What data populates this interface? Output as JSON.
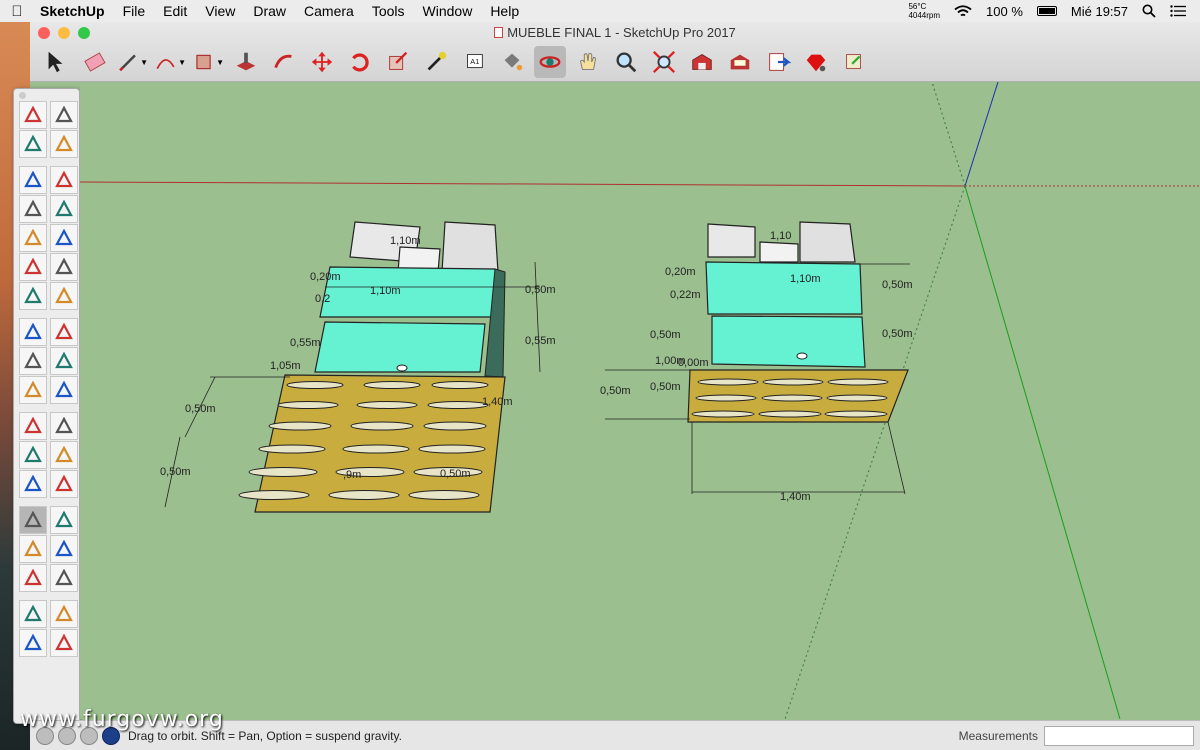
{
  "menubar": {
    "apple_icon": "apple-icon",
    "items": [
      "SketchUp",
      "File",
      "Edit",
      "View",
      "Draw",
      "Camera",
      "Tools",
      "Window",
      "Help"
    ],
    "temp": "56°C",
    "fan": "4044rpm",
    "battery": "100 %",
    "clock": "Mié 19:57"
  },
  "window": {
    "title": "MUEBLE FINAL 1 - SketchUp Pro 2017",
    "traffic_colors": [
      "#fc605c",
      "#fdbc40",
      "#34c84a"
    ]
  },
  "toolbar": {
    "tools": [
      {
        "name": "select-tool",
        "icon": "arrow-icon"
      },
      {
        "name": "eraser-tool",
        "icon": "eraser-icon"
      },
      {
        "name": "line-tool",
        "icon": "pencil-icon",
        "dropdown": true
      },
      {
        "name": "arc-tool",
        "icon": "arc-icon",
        "dropdown": true
      },
      {
        "name": "shape-tool",
        "icon": "rectangle-icon",
        "dropdown": true
      },
      {
        "name": "push-pull-tool",
        "icon": "push-pull-icon"
      },
      {
        "name": "offset-tool",
        "icon": "offset-icon"
      },
      {
        "name": "move-tool",
        "icon": "move-icon"
      },
      {
        "name": "rotate-tool",
        "icon": "rotate-icon"
      },
      {
        "name": "scale-tool",
        "icon": "scale-icon"
      },
      {
        "name": "tape-measure-tool",
        "icon": "tape-icon"
      },
      {
        "name": "text-tool",
        "icon": "text-icon"
      },
      {
        "name": "paint-bucket-tool",
        "icon": "paint-bucket-icon"
      },
      {
        "name": "orbit-tool",
        "icon": "orbit-icon",
        "active": true
      },
      {
        "name": "pan-tool",
        "icon": "hand-icon"
      },
      {
        "name": "zoom-tool",
        "icon": "magnifier-icon"
      },
      {
        "name": "zoom-extents-tool",
        "icon": "zoom-extents-icon"
      },
      {
        "name": "warehouse-tool",
        "icon": "warehouse-icon"
      },
      {
        "name": "extension-warehouse-tool",
        "icon": "extension-warehouse-icon"
      },
      {
        "name": "send-to-layout-tool",
        "icon": "layout-icon"
      },
      {
        "name": "extension-manager-tool",
        "icon": "ruby-icon"
      },
      {
        "name": "share-model-tool",
        "icon": "share-icon"
      }
    ],
    "text_icon_label": "A1"
  },
  "palette": {
    "tools": [
      "select-icon",
      "component-icon",
      "paint-bucket-icon",
      "eraser-icon",
      "sep",
      "line-icon",
      "freehand-icon",
      "rectangle-icon",
      "rotated-rectangle-icon",
      "circle-icon",
      "polygon-icon",
      "arc-icon",
      "two-point-arc-icon",
      "three-point-arc-icon",
      "pie-icon",
      "sep",
      "move-icon",
      "push-pull-icon",
      "rotate-icon",
      "follow-me-icon",
      "scale-icon",
      "offset-icon",
      "sep",
      "tape-icon",
      "dimension-icon",
      "protractor-icon",
      "text-icon",
      "axes-icon",
      "3d-text-icon",
      "sep",
      "orbit-icon",
      "pan-icon",
      "zoom-icon",
      "zoom-window-icon",
      "zoom-extents-icon",
      "previous-view-icon",
      "sep",
      "position-camera-icon",
      "walk-icon",
      "look-around-icon",
      "section-plane-icon"
    ],
    "active": "orbit-icon"
  },
  "scene": {
    "background": "#9bbf8e",
    "left_model": {
      "dimensions": [
        "1,10m",
        "0,20m",
        "0,2",
        "1,10m",
        "0,50m",
        "0,55m",
        "0,55m",
        "1,05m",
        "0,50m",
        "0,50m",
        "0,50m",
        "1,40m",
        ",9m"
      ]
    },
    "right_model": {
      "dimensions": [
        "1,10",
        "0,20m",
        "1,10m",
        "0,50m",
        "0,22m",
        "0,50m",
        "0,50m",
        "1,00m",
        "0,00m",
        "0,50m",
        "0,50m",
        "1,40m"
      ]
    }
  },
  "statusbar": {
    "hint": "Drag to orbit. Shift = Pan, Option = suspend gravity.",
    "measurements_label": "Measurements",
    "measurements_value": ""
  },
  "watermark": "www.furgovw.org"
}
